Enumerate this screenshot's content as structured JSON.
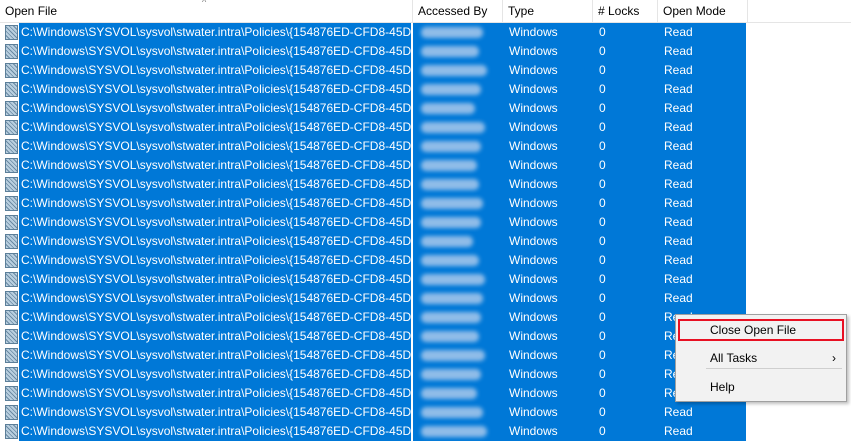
{
  "columns": [
    {
      "id": "open_file",
      "label": "Open File"
    },
    {
      "id": "accessed_by",
      "label": "Accessed By"
    },
    {
      "id": "type",
      "label": "Type"
    },
    {
      "id": "locks",
      "label": "# Locks"
    },
    {
      "id": "open_mode",
      "label": "Open Mode"
    }
  ],
  "rows": [
    {
      "path": "C:\\Windows\\SYSVOL\\sysvol\\stwater.intra\\Policies\\{154876ED-CFD8-45D...",
      "type": "Windows",
      "locks": "0",
      "mode": "Read"
    },
    {
      "path": "C:\\Windows\\SYSVOL\\sysvol\\stwater.intra\\Policies\\{154876ED-CFD8-45D...",
      "type": "Windows",
      "locks": "0",
      "mode": "Read"
    },
    {
      "path": "C:\\Windows\\SYSVOL\\sysvol\\stwater.intra\\Policies\\{154876ED-CFD8-45D...",
      "type": "Windows",
      "locks": "0",
      "mode": "Read"
    },
    {
      "path": "C:\\Windows\\SYSVOL\\sysvol\\stwater.intra\\Policies\\{154876ED-CFD8-45D...",
      "type": "Windows",
      "locks": "0",
      "mode": "Read"
    },
    {
      "path": "C:\\Windows\\SYSVOL\\sysvol\\stwater.intra\\Policies\\{154876ED-CFD8-45D...",
      "type": "Windows",
      "locks": "0",
      "mode": "Read"
    },
    {
      "path": "C:\\Windows\\SYSVOL\\sysvol\\stwater.intra\\Policies\\{154876ED-CFD8-45D...",
      "type": "Windows",
      "locks": "0",
      "mode": "Read"
    },
    {
      "path": "C:\\Windows\\SYSVOL\\sysvol\\stwater.intra\\Policies\\{154876ED-CFD8-45D...",
      "type": "Windows",
      "locks": "0",
      "mode": "Read"
    },
    {
      "path": "C:\\Windows\\SYSVOL\\sysvol\\stwater.intra\\Policies\\{154876ED-CFD8-45D...",
      "type": "Windows",
      "locks": "0",
      "mode": "Read"
    },
    {
      "path": "C:\\Windows\\SYSVOL\\sysvol\\stwater.intra\\Policies\\{154876ED-CFD8-45D...",
      "type": "Windows",
      "locks": "0",
      "mode": "Read"
    },
    {
      "path": "C:\\Windows\\SYSVOL\\sysvol\\stwater.intra\\Policies\\{154876ED-CFD8-45D...",
      "type": "Windows",
      "locks": "0",
      "mode": "Read"
    },
    {
      "path": "C:\\Windows\\SYSVOL\\sysvol\\stwater.intra\\Policies\\{154876ED-CFD8-45D...",
      "type": "Windows",
      "locks": "0",
      "mode": "Read"
    },
    {
      "path": "C:\\Windows\\SYSVOL\\sysvol\\stwater.intra\\Policies\\{154876ED-CFD8-45D...",
      "type": "Windows",
      "locks": "0",
      "mode": "Read"
    },
    {
      "path": "C:\\Windows\\SYSVOL\\sysvol\\stwater.intra\\Policies\\{154876ED-CFD8-45D...",
      "type": "Windows",
      "locks": "0",
      "mode": "Read"
    },
    {
      "path": "C:\\Windows\\SYSVOL\\sysvol\\stwater.intra\\Policies\\{154876ED-CFD8-45D...",
      "type": "Windows",
      "locks": "0",
      "mode": "Read"
    },
    {
      "path": "C:\\Windows\\SYSVOL\\sysvol\\stwater.intra\\Policies\\{154876ED-CFD8-45D...",
      "type": "Windows",
      "locks": "0",
      "mode": "Read"
    },
    {
      "path": "C:\\Windows\\SYSVOL\\sysvol\\stwater.intra\\Policies\\{154876ED-CFD8-45D...",
      "type": "Windows",
      "locks": "0",
      "mode": "Read"
    },
    {
      "path": "C:\\Windows\\SYSVOL\\sysvol\\stwater.intra\\Policies\\{154876ED-CFD8-45D...",
      "type": "Windows",
      "locks": "0",
      "mode": "Read"
    },
    {
      "path": "C:\\Windows\\SYSVOL\\sysvol\\stwater.intra\\Policies\\{154876ED-CFD8-45D...",
      "type": "Windows",
      "locks": "0",
      "mode": "Read"
    },
    {
      "path": "C:\\Windows\\SYSVOL\\sysvol\\stwater.intra\\Policies\\{154876ED-CFD8-45D...",
      "type": "Windows",
      "locks": "0",
      "mode": "Read"
    },
    {
      "path": "C:\\Windows\\SYSVOL\\sysvol\\stwater.intra\\Policies\\{154876ED-CFD8-45D...",
      "type": "Windows",
      "locks": "0",
      "mode": "Read"
    },
    {
      "path": "C:\\Windows\\SYSVOL\\sysvol\\stwater.intra\\Policies\\{154876ED-CFD8-45D...",
      "type": "Windows",
      "locks": "0",
      "mode": "Read"
    },
    {
      "path": "C:\\Windows\\SYSVOL\\sysvol\\stwater.intra\\Policies\\{154876ED-CFD8-45D...",
      "type": "Windows",
      "locks": "0",
      "mode": "Read"
    }
  ],
  "context_menu": {
    "items": [
      {
        "label": "Close Open File",
        "highlighted": true
      },
      {
        "label": "All Tasks",
        "submenu": true
      },
      {
        "label": "Help"
      }
    ],
    "submenu_arrow": "›"
  },
  "sort_indicator": "^",
  "colors": {
    "selection": "#0078d7",
    "highlight_border": "#e81123"
  },
  "icons": {
    "file": "file-icon",
    "sort": "sort-ascending-icon",
    "submenu": "chevron-right-icon"
  }
}
